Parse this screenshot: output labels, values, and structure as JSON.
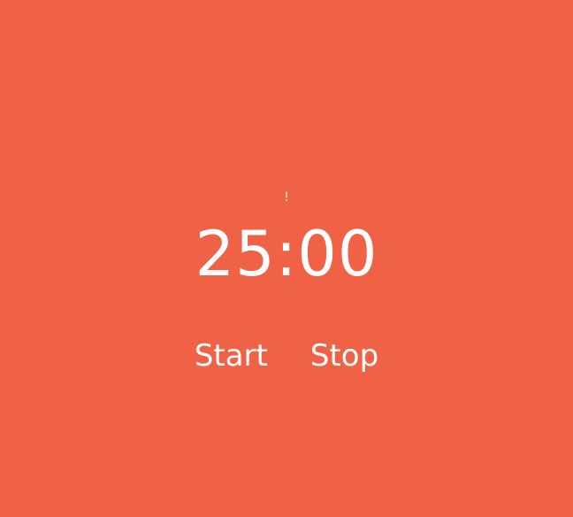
{
  "app": {
    "status_mark": "!",
    "time": "25:00",
    "controls": {
      "start_label": "Start",
      "stop_label": "Stop"
    }
  },
  "colors": {
    "background": "#F06246",
    "text": "#FFFFFF"
  }
}
